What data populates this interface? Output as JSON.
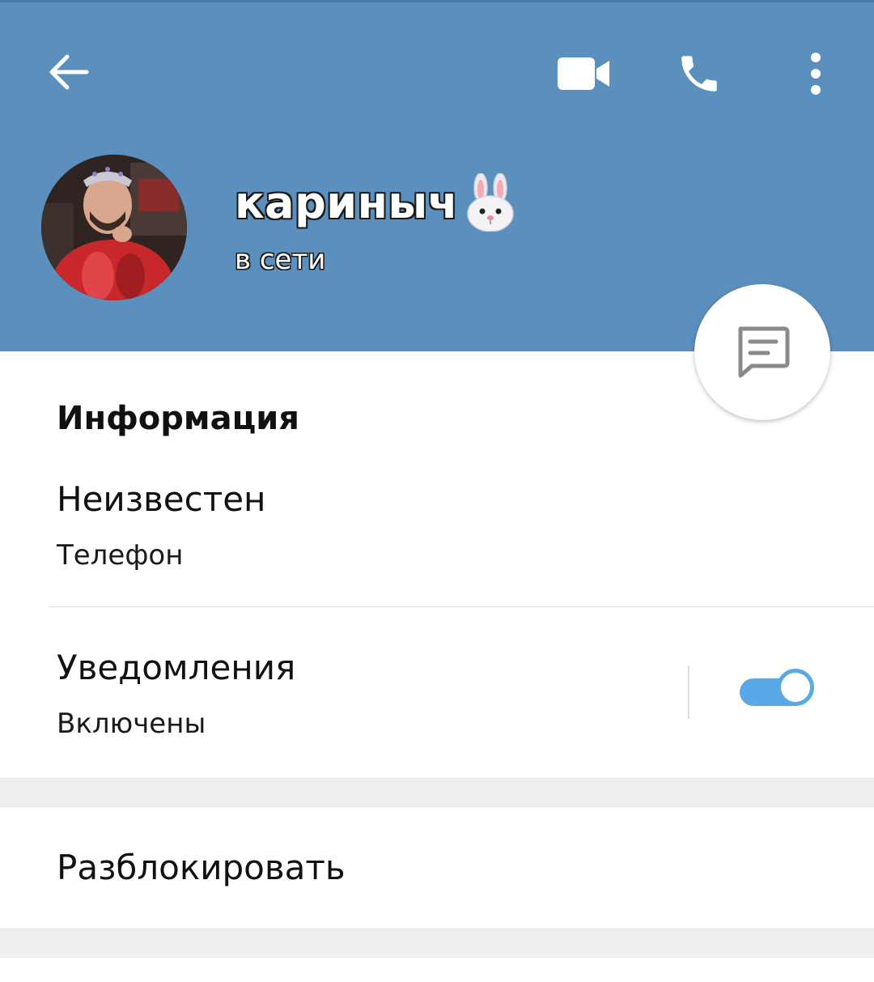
{
  "header": {
    "name": "кариныч",
    "status": "в сети",
    "background_color": "#5b8fbe",
    "icons": [
      "back-arrow-icon",
      "video-camera-icon",
      "phone-icon",
      "more-vert-icon"
    ]
  },
  "fab": {
    "icon": "message-icon"
  },
  "info": {
    "title": "Информация",
    "phone_value": "Неизвестен",
    "phone_label": "Телефон",
    "notifications_title": "Уведомления",
    "notifications_state": "Включены",
    "notifications_enabled": true,
    "toggle_color": "#5aa9e6"
  },
  "actions": {
    "unblock_label": "Разблокировать"
  }
}
